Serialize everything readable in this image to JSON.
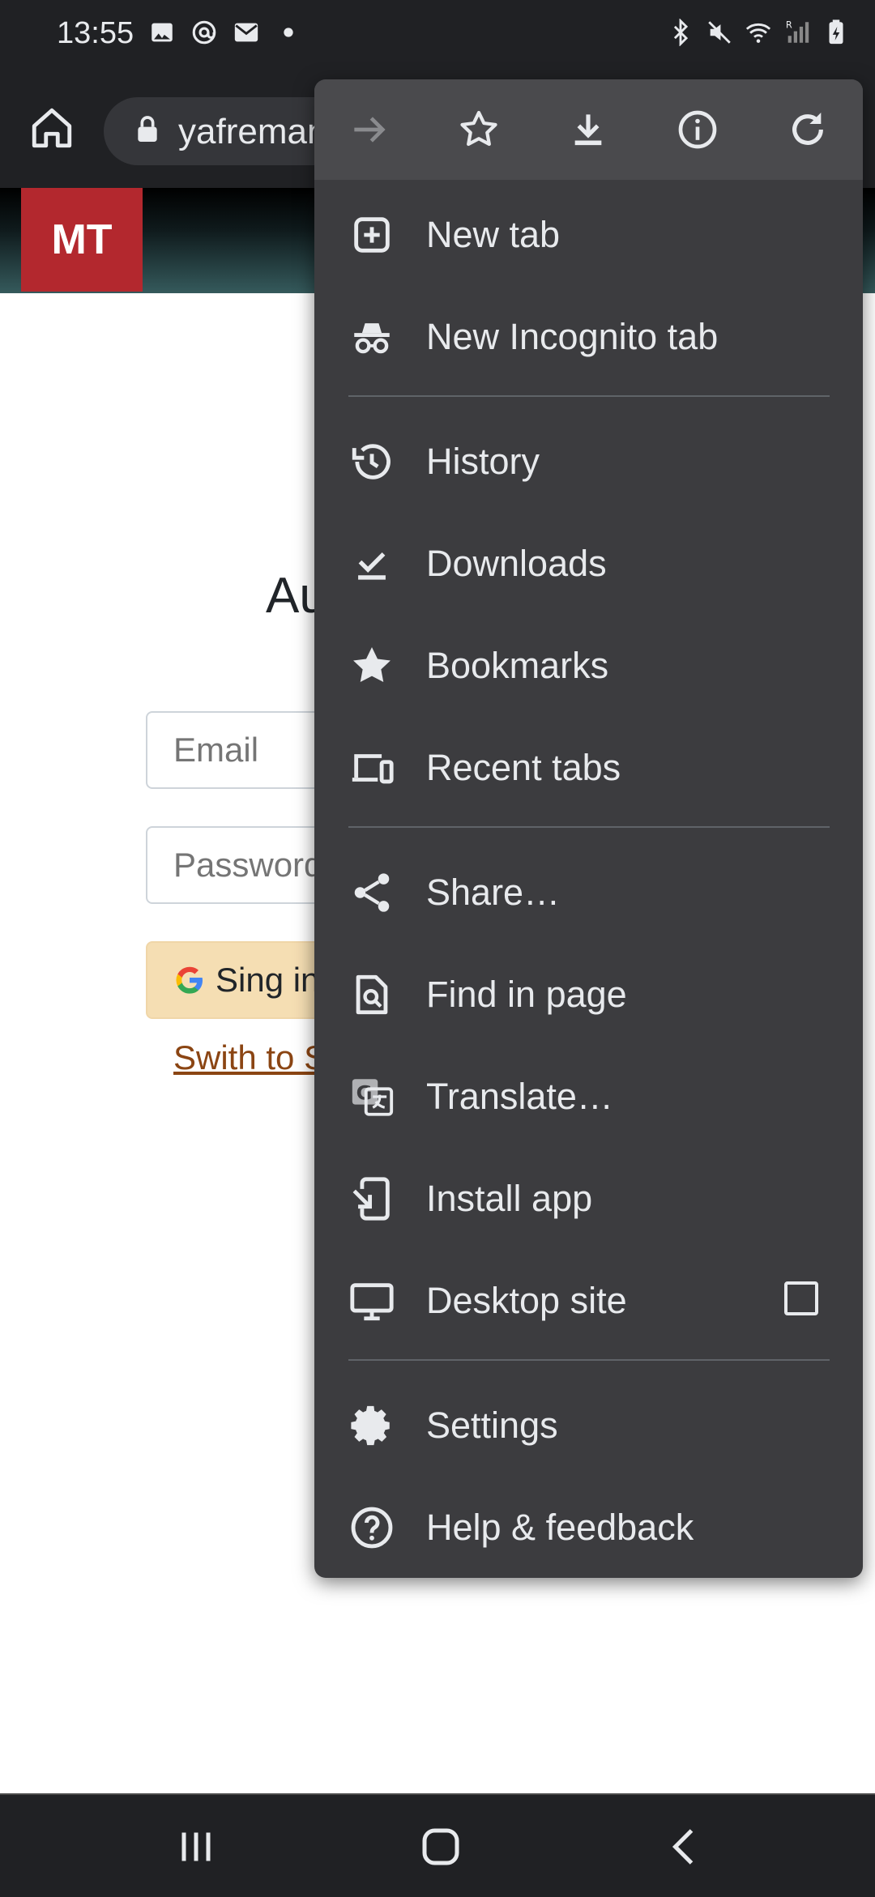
{
  "status_bar": {
    "time": "13:55",
    "left_icons": [
      "image-icon",
      "at-sign-icon",
      "mail-icon",
      "dot-icon"
    ],
    "right_icons": [
      "bluetooth-icon",
      "mute-icon",
      "wifi-icon",
      "signal-icon",
      "battery-icon"
    ],
    "signal_roaming_label": "R"
  },
  "toolbar": {
    "url": "yafremanov.ru"
  },
  "page": {
    "logo_text": "MT",
    "title": "Au",
    "email_placeholder": "Email",
    "password_placeholder": "Password",
    "google_button_label": "Sing in",
    "switch_link": "Swith to S"
  },
  "menu": {
    "icon_row": [
      "forward-icon",
      "bookmark-star-icon",
      "download-icon",
      "info-icon",
      "reload-icon"
    ],
    "items": [
      {
        "label": "New tab",
        "icon": "new-tab-icon"
      },
      {
        "label": "New Incognito tab",
        "icon": "incognito-icon"
      },
      {
        "label": "History",
        "icon": "history-icon"
      },
      {
        "label": "Downloads",
        "icon": "downloads-icon"
      },
      {
        "label": "Bookmarks",
        "icon": "bookmarks-icon"
      },
      {
        "label": "Recent tabs",
        "icon": "recent-tabs-icon"
      },
      {
        "label": "Share…",
        "icon": "share-icon"
      },
      {
        "label": "Find in page",
        "icon": "find-in-page-icon"
      },
      {
        "label": "Translate…",
        "icon": "translate-icon"
      },
      {
        "label": "Install app",
        "icon": "install-app-icon"
      },
      {
        "label": "Desktop site",
        "icon": "desktop-icon",
        "checked": false
      },
      {
        "label": "Settings",
        "icon": "settings-icon"
      },
      {
        "label": "Help & feedback",
        "icon": "help-icon"
      }
    ]
  },
  "nav_bar": {
    "buttons": [
      "recents-icon",
      "home-icon",
      "back-icon"
    ]
  },
  "colors": {
    "menu_bg": "#3c3c3f",
    "menu_header_bg": "#4a4a4d",
    "chrome_bar": "#202124",
    "logo_red": "#b3282e",
    "google_btn_bg": "#f5deb3",
    "link_brown": "#8b4513"
  }
}
